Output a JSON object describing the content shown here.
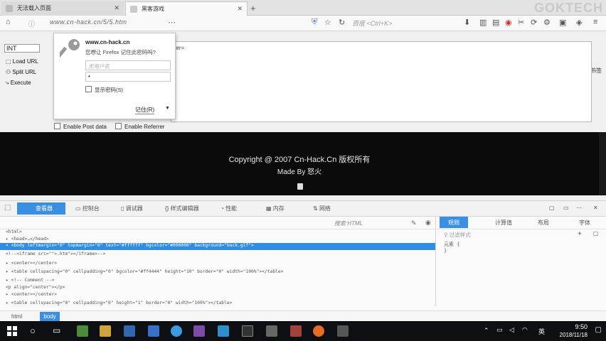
{
  "browser": {
    "tabs": [
      {
        "title": "无法载入页面"
      },
      {
        "title": "黑客游戏"
      }
    ],
    "new_tab": "+",
    "watermark": "GOKTECH",
    "url": "www.cn-hack.cn/5/5.htm",
    "search_placeholder": "百度 <Ctrl+K>",
    "mobile_bookmarks": "移动版书签"
  },
  "hackbar": {
    "items": [
      "INT",
      "Load URL",
      "Split URL",
      "Execute"
    ],
    "textbox_fragment": "her=",
    "enable_post": "Enable Post data",
    "enable_referrer": "Enable Referrer"
  },
  "password_popup": {
    "site": "www.cn-hack.cn",
    "question": "您想让 Firefox 记住此密码吗?",
    "username_placeholder": "无用户名",
    "password_value": "•",
    "show_password": "显示密码(S)",
    "remember": "记住(R)"
  },
  "page": {
    "copyright": "Copyright @ 2007 Cn-Hack.Cn 版权所有",
    "made_by": "Made By 怒火",
    "background": "#000000"
  },
  "devtools": {
    "tabs": [
      "查看器",
      "控制台",
      "调试器",
      "样式编辑器",
      "性能",
      "内存",
      "网络"
    ],
    "search_placeholder": "搜索 HTML",
    "rule_tabs": [
      "规则",
      "计算值",
      "布局",
      "字体"
    ],
    "rules_filter": "过滤样式",
    "element_rule_open": "元素 {",
    "element_rule_close": "}",
    "code_lines": [
      "<html>",
      "  ▸ <head>…</head>",
      "▾ <body leftmargin=\"0\" topmargin=\"0\" text=\"#ffffff\" bgcolor=\"#000000\" background=\"back.gif\">",
      "    <!--<iframe src=\"\">.htm\"></iframe>-->",
      "  ▸ <center></center>",
      "  ▸ <table cellspacing=\"0\" cellpadding=\"0\" bgcolor=\"#ff4444\" height=\"10\" border=\"0\" width=\"100%\"></table>",
      "  ▸ <!-- Comment -->",
      "    <p align=\"center\"></p>",
      "  ▸ <center></center>",
      "  ▸ <table cellspacing=\"0\" cellpadding=\"0\" height=\"1\" border=\"0\" width=\"100%\"></table>"
    ],
    "breadcrumbs": [
      "html",
      "body"
    ],
    "accent": "#3b8fe3"
  },
  "taskbar": {
    "ime": "英",
    "time": "9:50",
    "date": "2018/11/18"
  }
}
